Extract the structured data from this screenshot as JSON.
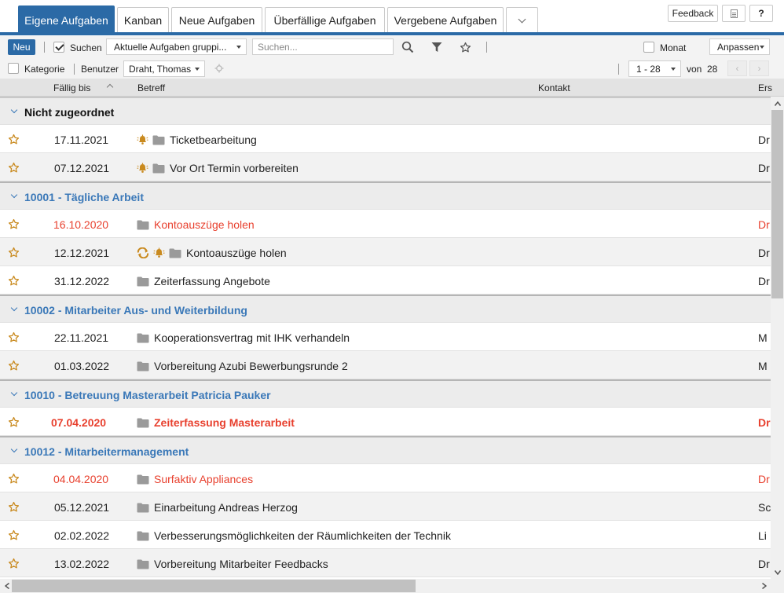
{
  "tabs": [
    {
      "label": "Eigene Aufgaben",
      "active": true
    },
    {
      "label": "Kanban",
      "active": false
    },
    {
      "label": "Neue Aufgaben",
      "active": false
    },
    {
      "label": "Überfällige Aufgaben",
      "active": false
    },
    {
      "label": "Vergebene Aufgaben",
      "active": false
    }
  ],
  "top_buttons": {
    "feedback": "Feedback",
    "help": "?"
  },
  "toolbar": {
    "new_label": "Neu",
    "search_label": "Suchen",
    "search_checked": true,
    "view_select": "Aktuelle Aufgaben gruppi...",
    "search_placeholder": "Suchen...",
    "month_label": "Monat",
    "month_checked": false,
    "customize_select": "Anpassen",
    "category_label": "Kategorie",
    "category_checked": false,
    "user_label": "Benutzer",
    "user_select": "Draht, Thomas",
    "range_select": "1 - 28",
    "of_label": "von",
    "total": "28"
  },
  "columns": {
    "due": "Fällig bis",
    "subject": "Betreff",
    "contact": "Kontakt",
    "creator": "Ers"
  },
  "colors": {
    "accent": "#2b6aa6",
    "group_title": "#3a78b8",
    "overdue": "#e8402e",
    "star": "#c98a1f",
    "folder": "#9a9a9a"
  },
  "groups": [
    {
      "title": "Nicht zugeordnet",
      "style": "black",
      "tasks": [
        {
          "date": "17.11.2021",
          "subject": "Ticketbearbeitung",
          "icons": [
            "bell-icon"
          ],
          "creator": "Dr",
          "state": "normal"
        },
        {
          "date": "07.12.2021",
          "subject": "Vor Ort Termin vorbereiten",
          "icons": [
            "bell-icon"
          ],
          "creator": "Dr",
          "state": "normal"
        }
      ]
    },
    {
      "title": "10001 - Tägliche Arbeit",
      "style": "blue",
      "tasks": [
        {
          "date": "16.10.2020",
          "subject": "Kontoauszüge holen",
          "icons": [],
          "creator": "Dr",
          "state": "overdue"
        },
        {
          "date": "12.12.2021",
          "subject": "Kontoauszüge holen",
          "icons": [
            "recurring-icon",
            "bell-icon"
          ],
          "creator": "Dr",
          "state": "normal"
        },
        {
          "date": "31.12.2022",
          "subject": "Zeiterfassung Angebote",
          "icons": [],
          "creator": "Dr",
          "state": "normal"
        }
      ]
    },
    {
      "title": "10002 - Mitarbeiter Aus- und Weiterbildung",
      "style": "blue",
      "tasks": [
        {
          "date": "22.11.2021",
          "subject": "Kooperationsvertrag mit IHK verhandeln",
          "icons": [],
          "creator": "M",
          "state": "normal"
        },
        {
          "date": "01.03.2022",
          "subject": "Vorbereitung Azubi Bewerbungsrunde 2",
          "icons": [],
          "creator": "M",
          "state": "normal"
        }
      ]
    },
    {
      "title": "10010 - Betreuung Masterarbeit Patricia Pauker",
      "style": "blue",
      "tasks": [
        {
          "date": "07.04.2020",
          "subject": "Zeiterfassung Masterarbeit",
          "icons": [],
          "creator": "Dr",
          "state": "overdue-bold"
        }
      ]
    },
    {
      "title": "10012 - Mitarbeitermanagement",
      "style": "blue",
      "tasks": [
        {
          "date": "04.04.2020",
          "subject": "Surfaktiv Appliances",
          "icons": [],
          "creator": "Dr",
          "state": "overdue"
        },
        {
          "date": "05.12.2021",
          "subject": "Einarbeitung Andreas Herzog",
          "icons": [],
          "creator": "Sc",
          "state": "normal"
        },
        {
          "date": "02.02.2022",
          "subject": "Verbesserungsmöglichkeiten der Räumlichkeiten der Technik",
          "icons": [],
          "creator": "Li",
          "state": "normal"
        },
        {
          "date": "13.02.2022",
          "subject": "Vorbereitung Mitarbeiter Feedbacks",
          "icons": [],
          "creator": "Dr",
          "state": "normal"
        }
      ]
    }
  ]
}
